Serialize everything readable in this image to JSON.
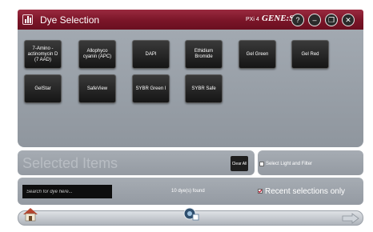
{
  "titlebar": {
    "title": "Dye Selection",
    "model": "PXi 4",
    "brand": "GENE:Sys",
    "buttons": [
      {
        "name": "help-icon",
        "glyph": "?"
      },
      {
        "name": "minimize-icon",
        "glyph": "–"
      },
      {
        "name": "restore-icon",
        "glyph": "❐"
      },
      {
        "name": "close-icon",
        "glyph": "✕"
      }
    ]
  },
  "dyes": [
    {
      "label": "7-Amino - actinomycin D (7 AAD)"
    },
    {
      "label": "Allophyco cyanin (APC)"
    },
    {
      "label": "DAPI"
    },
    {
      "label": "Ethidium Bromide"
    },
    {
      "label": "Gel Green"
    },
    {
      "label": "Gel Red"
    },
    {
      "label": "GelStar"
    },
    {
      "label": "SafeView"
    },
    {
      "label": "SYBR Green I"
    },
    {
      "label": "SYBR Safe"
    }
  ],
  "selected": {
    "title": "Selected Items",
    "clear_label": "Clear All",
    "light_filter_label": "Select Light and Filter",
    "light_filter_checked": false
  },
  "search": {
    "placeholder": "Search for dye here...",
    "found_text": "10 dye(s) found",
    "recent_label": "Recent selections only",
    "recent_checked": true
  },
  "nav": {
    "home_icon": "home-icon",
    "center_icon": "camera-icon",
    "next_icon": "forward-arrow-icon"
  },
  "colors": {
    "titlebar": "#7a1528",
    "panel": "#9aa1a9",
    "dye_button": "#1e1e1e"
  }
}
